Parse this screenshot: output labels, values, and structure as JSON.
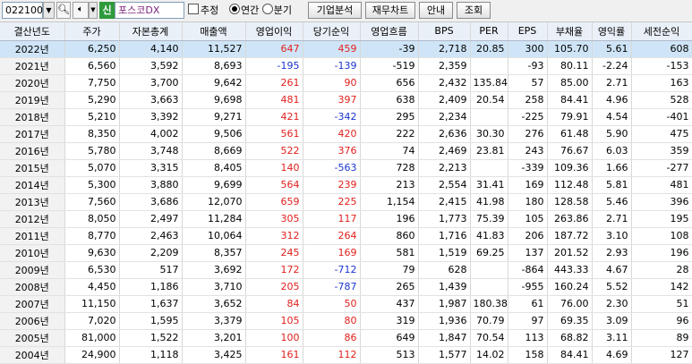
{
  "toolbar": {
    "code": "022100",
    "search_icon": "search-icon",
    "speaker_icon": "speaker-icon",
    "badge": "신",
    "name": "포스코DX",
    "estimate_label": "추정",
    "annual_label": "연간",
    "quarterly_label": "분기",
    "btn_analysis": "기업분석",
    "btn_chart": "재무차트",
    "btn_guide": "안내",
    "btn_query": "조회",
    "colors": {
      "badge": "#2f9a3c",
      "name": "#7a1f7a"
    }
  },
  "table": {
    "headers": [
      "결산년도",
      "주가",
      "자본총계",
      "매출액",
      "영업이익",
      "당기순익",
      "영업흐름",
      "BPS",
      "PER",
      "EPS",
      "부채율",
      "영익률",
      "세전순익"
    ],
    "rows": [
      [
        "2022년",
        "6,250",
        "4,140",
        "11,527",
        "647",
        "459",
        "-39",
        "2,718",
        "20.85",
        "300",
        "105.70",
        "5.61",
        "608"
      ],
      [
        "2021년",
        "6,560",
        "3,592",
        "8,693",
        "-195",
        "-139",
        "-519",
        "2,359",
        "",
        "-93",
        "80.11",
        "-2.24",
        "-153"
      ],
      [
        "2020년",
        "7,750",
        "3,700",
        "9,642",
        "261",
        "90",
        "656",
        "2,432",
        "135.84",
        "57",
        "85.00",
        "2.71",
        "163"
      ],
      [
        "2019년",
        "5,290",
        "3,663",
        "9,698",
        "481",
        "397",
        "638",
        "2,409",
        "20.54",
        "258",
        "84.41",
        "4.96",
        "528"
      ],
      [
        "2018년",
        "5,210",
        "3,392",
        "9,271",
        "421",
        "-342",
        "295",
        "2,234",
        "",
        "-225",
        "79.91",
        "4.54",
        "-401"
      ],
      [
        "2017년",
        "8,350",
        "4,002",
        "9,506",
        "561",
        "420",
        "222",
        "2,636",
        "30.30",
        "276",
        "61.48",
        "5.90",
        "475"
      ],
      [
        "2016년",
        "5,780",
        "3,748",
        "8,669",
        "522",
        "376",
        "74",
        "2,469",
        "23.81",
        "243",
        "76.67",
        "6.03",
        "359"
      ],
      [
        "2015년",
        "5,070",
        "3,315",
        "8,405",
        "140",
        "-563",
        "728",
        "2,213",
        "",
        "-339",
        "109.36",
        "1.66",
        "-277"
      ],
      [
        "2014년",
        "5,300",
        "3,880",
        "9,699",
        "564",
        "239",
        "213",
        "2,554",
        "31.41",
        "169",
        "112.48",
        "5.81",
        "481"
      ],
      [
        "2013년",
        "7,560",
        "3,686",
        "12,070",
        "659",
        "225",
        "1,154",
        "2,415",
        "41.98",
        "180",
        "128.58",
        "5.46",
        "396"
      ],
      [
        "2012년",
        "8,050",
        "2,497",
        "11,284",
        "305",
        "117",
        "196",
        "1,773",
        "75.39",
        "105",
        "263.86",
        "2.71",
        "195"
      ],
      [
        "2011년",
        "8,770",
        "2,463",
        "10,064",
        "312",
        "264",
        "860",
        "1,716",
        "41.83",
        "206",
        "187.72",
        "3.10",
        "108"
      ],
      [
        "2010년",
        "9,630",
        "2,209",
        "8,357",
        "245",
        "169",
        "581",
        "1,519",
        "69.25",
        "137",
        "201.52",
        "2.93",
        "196"
      ],
      [
        "2009년",
        "6,530",
        "517",
        "3,692",
        "172",
        "-712",
        "79",
        "628",
        "",
        "-864",
        "443.33",
        "4.67",
        "28"
      ],
      [
        "2008년",
        "4,450",
        "1,186",
        "3,710",
        "205",
        "-787",
        "265",
        "1,439",
        "",
        "-955",
        "160.24",
        "5.52",
        "142"
      ],
      [
        "2007년",
        "11,150",
        "1,637",
        "3,652",
        "84",
        "50",
        "437",
        "1,987",
        "180.38",
        "61",
        "76.00",
        "2.30",
        "51"
      ],
      [
        "2006년",
        "7,020",
        "1,595",
        "3,379",
        "105",
        "80",
        "319",
        "1,936",
        "70.79",
        "97",
        "69.35",
        "3.09",
        "96"
      ],
      [
        "2005년",
        "81,000",
        "1,522",
        "3,201",
        "100",
        "86",
        "649",
        "1,847",
        "70.54",
        "113",
        "68.82",
        "3.11",
        "89"
      ],
      [
        "2004년",
        "24,900",
        "1,118",
        "3,425",
        "161",
        "112",
        "513",
        "1,577",
        "14.02",
        "158",
        "84.41",
        "4.69",
        "127"
      ]
    ],
    "selected_row": 0,
    "colors": {
      "positive": "#e0201c",
      "negative": "#1a36d0",
      "selected": "#cfe5f7",
      "header": "#eaf0f8"
    }
  }
}
